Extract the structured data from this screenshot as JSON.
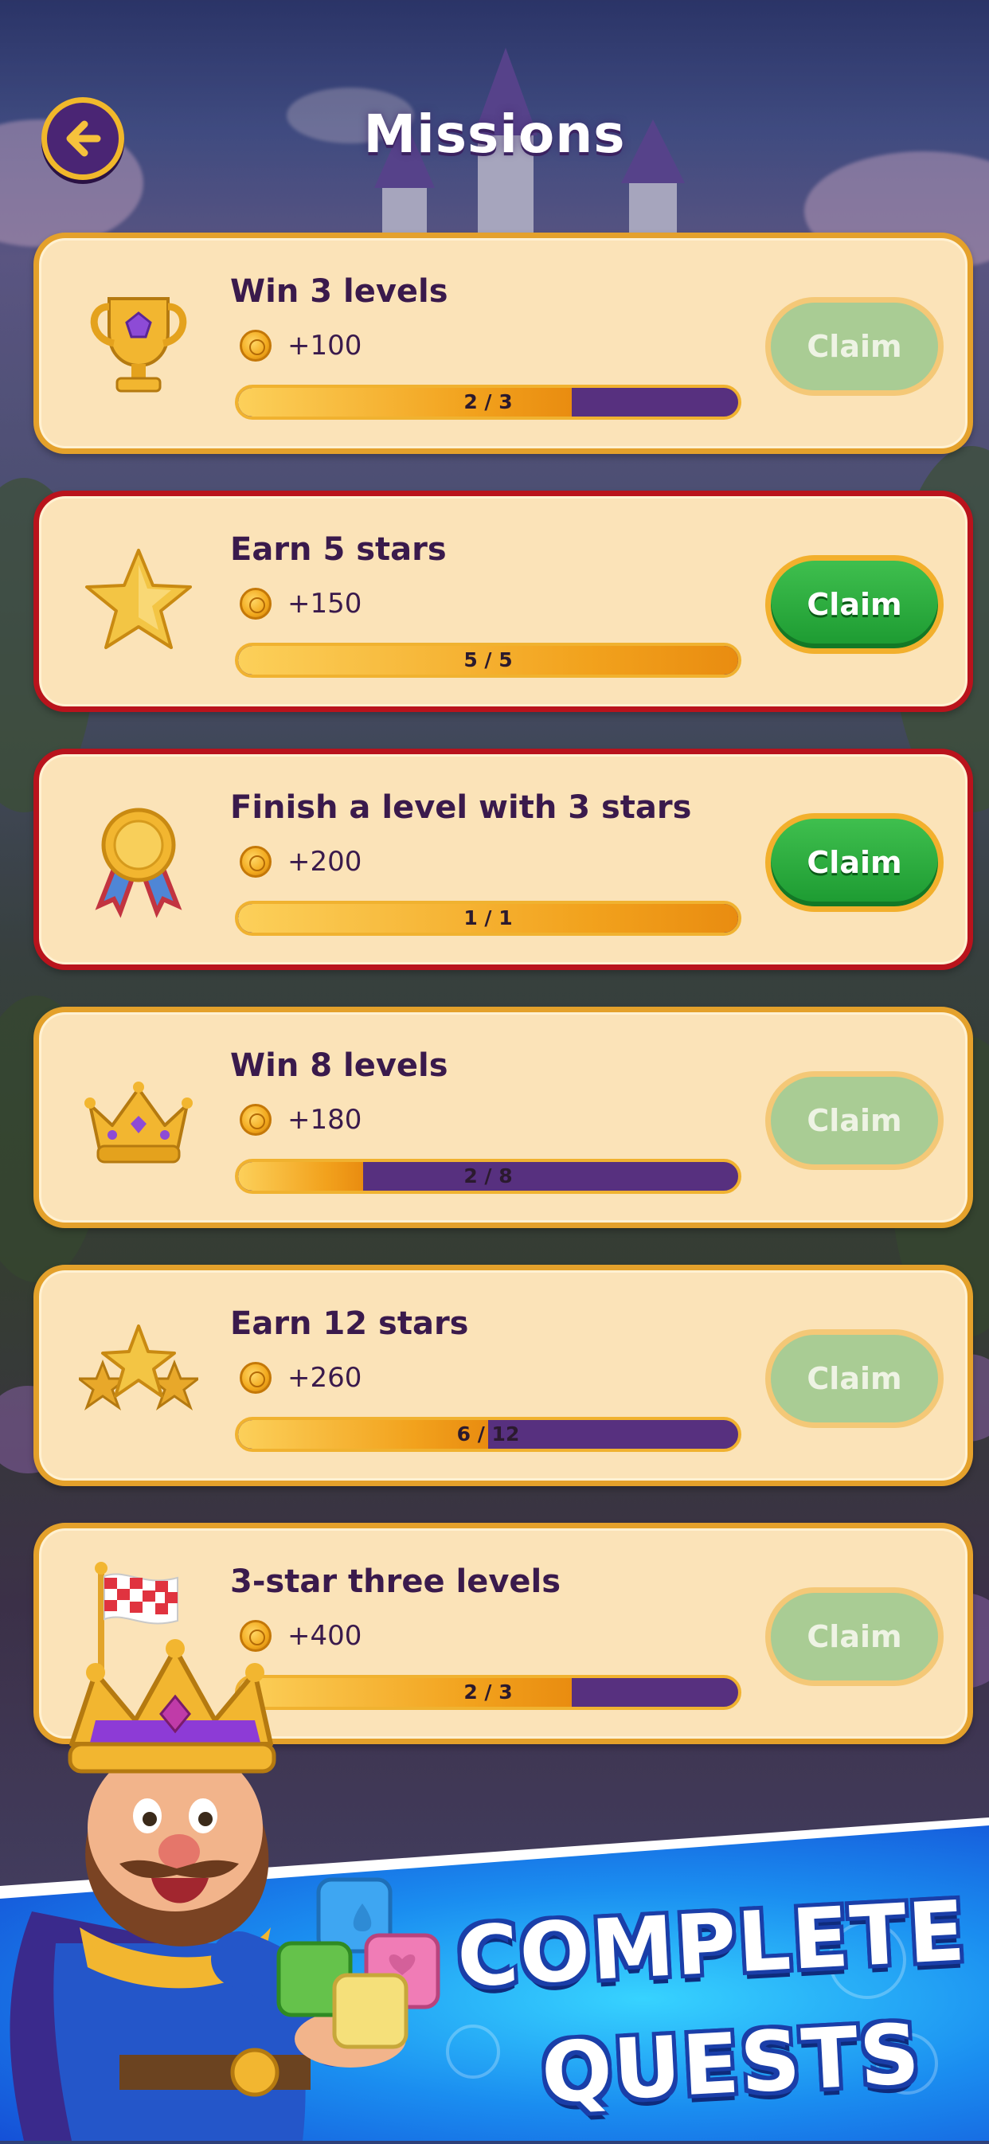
{
  "header": {
    "title": "Missions",
    "back_icon": "arrow-left-icon"
  },
  "colors": {
    "card_bg": "#fbe3b8",
    "card_border": "#e4a12b",
    "card_border_ready": "#b9131c",
    "progress_track": "#57307f",
    "progress_fill": "#f2a21d",
    "claim_active": "#1c9a31",
    "claim_disabled": "#a9cc94",
    "banner_blue": "#1a8df0"
  },
  "missions": [
    {
      "title": "Win 3 levels",
      "reward": "+100",
      "progress_text": "2 / 3",
      "progress": 0.667,
      "claim": "Claim",
      "claimable": false,
      "icon": "trophy-icon"
    },
    {
      "title": "Earn 5 stars",
      "reward": "+150",
      "progress_text": "5 / 5",
      "progress": 1.0,
      "claim": "Claim",
      "claimable": true,
      "icon": "star-icon"
    },
    {
      "title": "Finish a level with 3 stars",
      "reward": "+200",
      "progress_text": "1 / 1",
      "progress": 1.0,
      "claim": "Claim",
      "claimable": true,
      "icon": "medal-icon"
    },
    {
      "title": "Win 8 levels",
      "reward": "+180",
      "progress_text": "2 / 8",
      "progress": 0.25,
      "claim": "Claim",
      "claimable": false,
      "icon": "crown-icon"
    },
    {
      "title": "Earn 12 stars",
      "reward": "+260",
      "progress_text": "6 / 12",
      "progress": 0.5,
      "claim": "Claim",
      "claimable": false,
      "icon": "three-stars-icon"
    },
    {
      "title": "3-star three levels",
      "reward": "+400",
      "progress_text": "2 / 3",
      "progress": 0.667,
      "claim": "Claim",
      "claimable": false,
      "icon": "checkered-flag-icon"
    }
  ],
  "banner": {
    "line1": "COMPLETE",
    "line2": "QUESTS"
  }
}
